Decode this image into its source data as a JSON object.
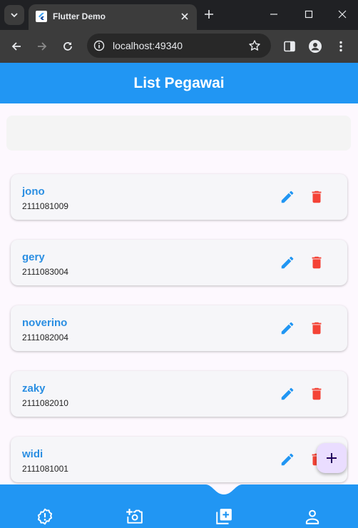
{
  "browser": {
    "tab_title": "Flutter Demo",
    "url": "localhost:49340"
  },
  "app": {
    "title": "List Pegawai",
    "search": {
      "value": "",
      "placeholder": ""
    },
    "employees": [
      {
        "name": "jono",
        "nip": "2111081009"
      },
      {
        "name": "gery",
        "nip": "2111083004"
      },
      {
        "name": "noverino",
        "nip": "2111082004"
      },
      {
        "name": "zaky",
        "nip": "2111082010"
      },
      {
        "name": "widi",
        "nip": "2111081001"
      }
    ],
    "fab_icon": "plus-icon",
    "bottom_nav": [
      {
        "icon": "alert-badge-icon"
      },
      {
        "icon": "add-photo-icon"
      },
      {
        "icon": "library-add-icon"
      },
      {
        "icon": "person-icon"
      }
    ]
  },
  "colors": {
    "primary": "#2196f3",
    "name_text": "#2a8ee2",
    "edit_icon": "#2196f3",
    "delete_icon": "#f44336",
    "fab_bg": "#eaddff",
    "app_bg": "#fdf8fe"
  }
}
